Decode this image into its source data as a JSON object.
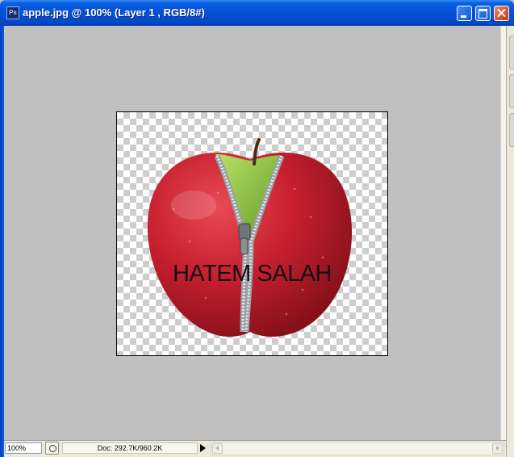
{
  "window": {
    "title": "apple.jpg @ 100% (Layer 1 , RGB/8#)",
    "app_icon_label": "Ps"
  },
  "canvas": {
    "text_layer": "HATEM SALAH",
    "background": "transparent-checkerboard"
  },
  "status": {
    "zoom": "100%",
    "doc_info": "Doc: 292.7K/960.2K"
  },
  "icons": {
    "minimize": "minimize-icon",
    "maximize": "maximize-icon",
    "close": "close-icon",
    "status_menu": "triangle-right-icon"
  },
  "colors": {
    "titlebar": "#0553d6",
    "canvas_bg": "#c0c0c0",
    "apple_red": "#c8202f",
    "apple_green": "#8cc63e"
  }
}
